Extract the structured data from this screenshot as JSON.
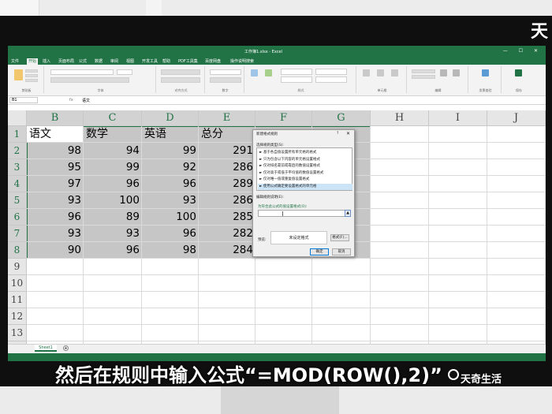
{
  "brand_corner": "天",
  "excel": {
    "title": "工作簿1.xlsx - Excel",
    "window_controls": "— ☐ ✕",
    "menu": [
      "文件",
      "开始",
      "插入",
      "页面布局",
      "公式",
      "数据",
      "审阅",
      "视图",
      "开发工具",
      "帮助",
      "PDF工具集",
      "百度网盘",
      "操作说明搜索"
    ],
    "active_menu": "开始",
    "ribbon_groups": [
      "剪贴板",
      "字体",
      "对齐方式",
      "数字",
      "样式",
      "单元格",
      "编辑",
      "发票查验",
      "保存"
    ],
    "name_box": "B1",
    "fx": "fx",
    "formula_value": "语文",
    "columns": [
      "B",
      "C",
      "D",
      "E",
      "F",
      "G",
      "H",
      "I",
      "J"
    ],
    "rows": [
      "1",
      "2",
      "3",
      "4",
      "5",
      "6",
      "7",
      "8",
      "9",
      "10",
      "11",
      "12",
      "13",
      "14"
    ],
    "table": {
      "headers": [
        "语文",
        "数学",
        "英语",
        "总分"
      ],
      "data": [
        [
          "98",
          "94",
          "99",
          "291"
        ],
        [
          "95",
          "99",
          "92",
          "286"
        ],
        [
          "97",
          "96",
          "96",
          "289"
        ],
        [
          "93",
          "100",
          "93",
          "286"
        ],
        [
          "96",
          "89",
          "100",
          "285"
        ],
        [
          "93",
          "93",
          "96",
          "282"
        ],
        [
          "90",
          "96",
          "98",
          "284"
        ]
      ]
    },
    "sheet_tab": "Sheet1",
    "add_sheet": "+"
  },
  "dialog": {
    "title": "新建格式规则",
    "help": "?",
    "close": "✕",
    "select_rule_type_label": "选择规则类型(S):",
    "rules": [
      "► 基于各自值设置所有单元格的格式",
      "► 只为包含以下内容的单元格设置格式",
      "► 仅对排名靠前或靠后的数值设置格式",
      "► 仅对高于或低于平均值的数值设置格式",
      "► 仅对唯一值或重复值设置格式",
      "► 使用公式确定要设置格式的单元格"
    ],
    "selected_rule_index": 5,
    "edit_rule_label": "编辑规则说明(E):",
    "formula_label": "为符合此公式的值设置格式(O):",
    "formula_value": "",
    "collapse_button": "▲",
    "preview_label": "预览:",
    "preview_text": "未设定格式",
    "format_button": "格式(F)...",
    "ok_button": "确定",
    "cancel_button": "取消"
  },
  "caption": "然后在规则中输入公式“=MOD(ROW(),2)”",
  "watermark": "天奇生活",
  "colors": {
    "excel_green": "#217346",
    "selection_gray": "#c6c6c6",
    "dialog_bg": "#f0f0f0"
  }
}
